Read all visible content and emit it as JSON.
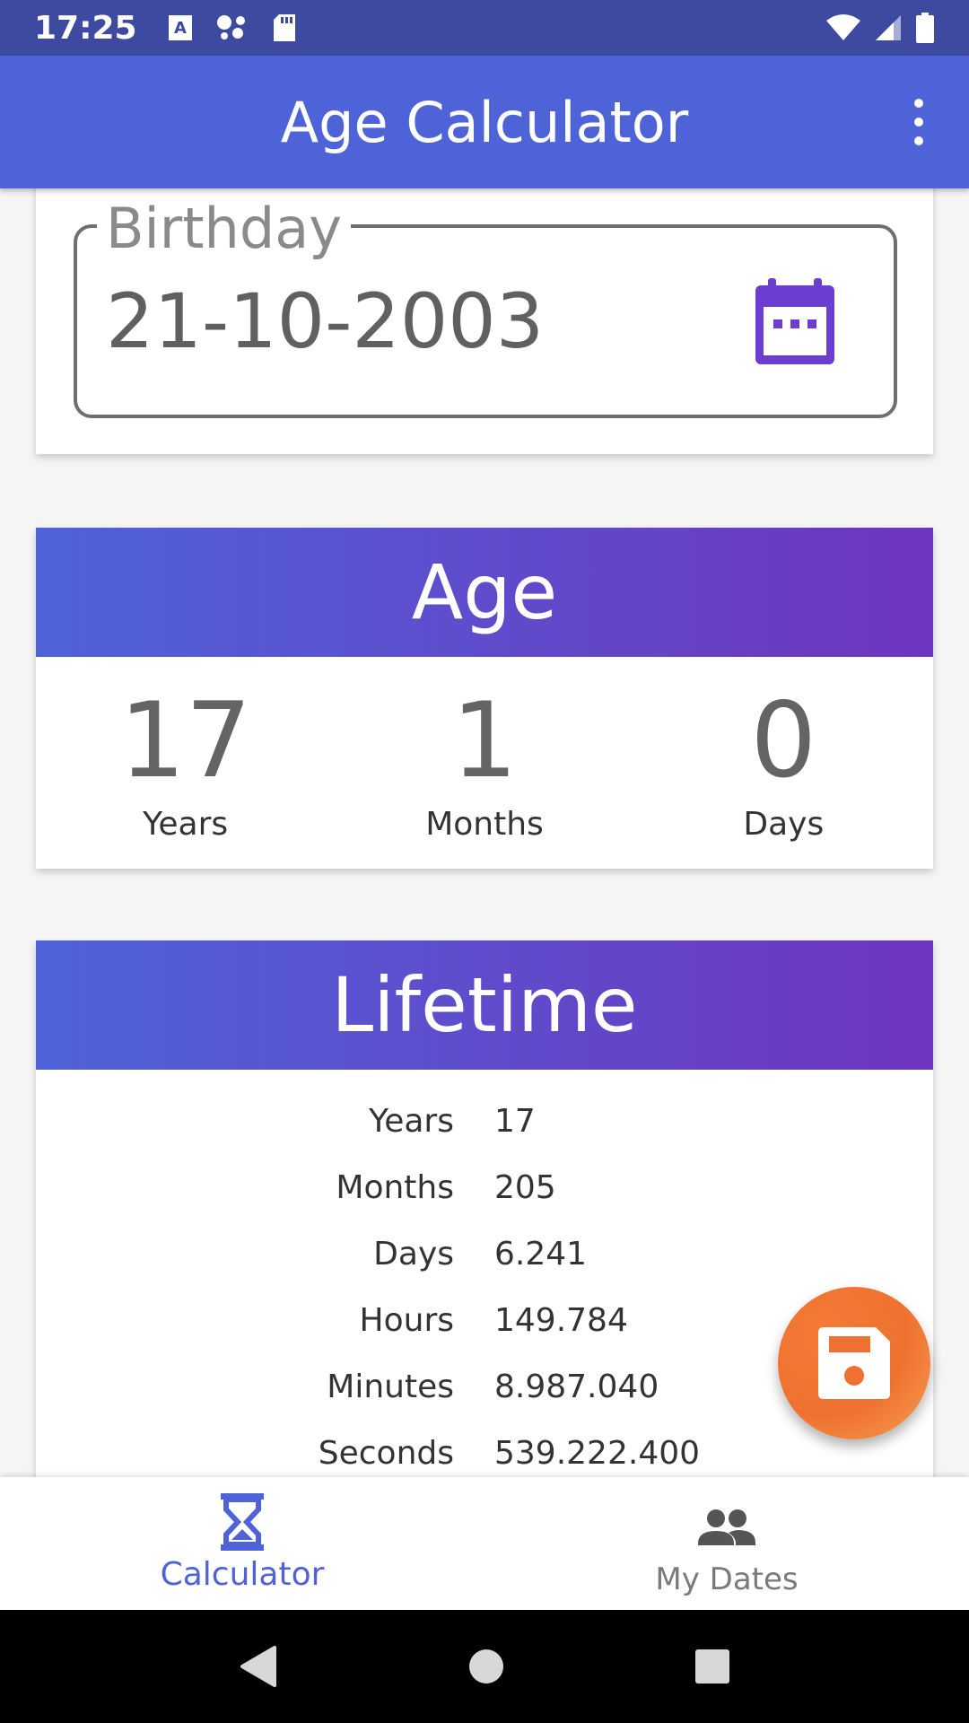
{
  "status_bar": {
    "time": "17:25",
    "left_icons": [
      "text-a-icon",
      "assistant-dots-icon",
      "sd-card-icon"
    ],
    "right_icons": [
      "wifi-icon",
      "signal-icon",
      "battery-icon"
    ]
  },
  "app_bar": {
    "title": "Age Calculator",
    "menu_icon": "more-vert-icon"
  },
  "birthday": {
    "label": "Birthday",
    "value": "21-10-2003",
    "icon": "calendar-icon"
  },
  "age": {
    "title": "Age",
    "items": [
      {
        "value": "17",
        "unit": "Years"
      },
      {
        "value": "1",
        "unit": "Months"
      },
      {
        "value": "0",
        "unit": "Days"
      }
    ]
  },
  "lifetime": {
    "title": "Lifetime",
    "rows": [
      {
        "label": "Years",
        "value": "17"
      },
      {
        "label": "Months",
        "value": "205"
      },
      {
        "label": "Days",
        "value": "6.241"
      },
      {
        "label": "Hours",
        "value": "149.784"
      },
      {
        "label": "Minutes",
        "value": "8.987.040"
      },
      {
        "label": "Seconds",
        "value": "539.222.400"
      }
    ]
  },
  "fab": {
    "icon": "save-icon"
  },
  "bottom_nav": {
    "items": [
      {
        "label": "Calculator",
        "icon": "hourglass-icon",
        "active": true
      },
      {
        "label": "My Dates",
        "icon": "people-icon",
        "active": false
      }
    ]
  },
  "colors": {
    "status_bar": "#3d4aa0",
    "app_bar": "#4f63d8",
    "gradient_start": "#4f63d8",
    "gradient_end": "#6e35bf",
    "fab": "#f0712f",
    "calendar_icon": "#6a3fd0"
  }
}
